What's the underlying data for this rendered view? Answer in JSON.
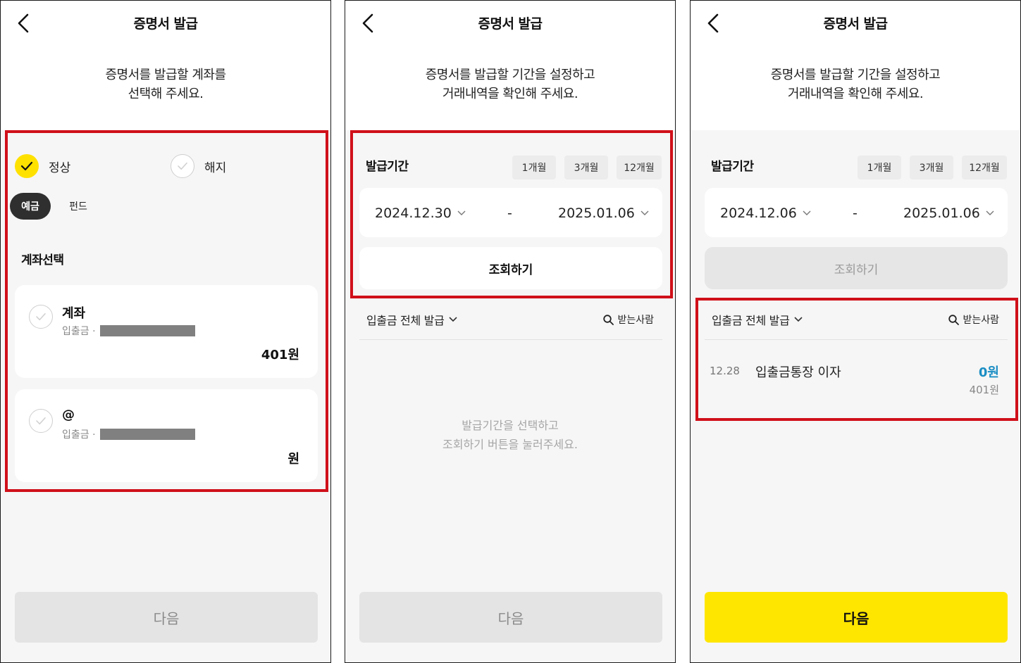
{
  "colors": {
    "accent_yellow": "#ffe600",
    "highlight_red": "#d0101a",
    "amount_blue": "#1b8ec4"
  },
  "panel1": {
    "title": "증명서 발급",
    "desc_line1": "증명서를 발급할 계좌를",
    "desc_line2": "선택해 주세요.",
    "radio_normal": "정상",
    "radio_closed": "해지",
    "tab_deposit": "예금",
    "tab_fund": "펀드",
    "section_label": "계좌선택",
    "accounts": [
      {
        "name": "계좌",
        "type": "입출금 ·",
        "amount": "401원"
      },
      {
        "name": "@",
        "type": "입출금 ·",
        "amount": "원"
      }
    ],
    "next_label": "다음"
  },
  "panel2": {
    "title": "증명서 발급",
    "desc_line1": "증명서를 발급할 기간을 설정하고",
    "desc_line2": "거래내역을 확인해 주세요.",
    "period_label": "발급기간",
    "chips": [
      "1개월",
      "3개월",
      "12개월"
    ],
    "date_from": "2024.12.30",
    "date_to": "2025.01.06",
    "dash": "-",
    "query_label": "조회하기",
    "filter_label": "입출금 전체 발급",
    "recipient_label": "받는사람",
    "empty_line1": "발급기간을 선택하고",
    "empty_line2": "조회하기 버튼을 눌러주세요.",
    "next_label": "다음"
  },
  "panel3": {
    "title": "증명서 발급",
    "desc_line1": "증명서를 발급할 기간을 설정하고",
    "desc_line2": "거래내역을 확인해 주세요.",
    "period_label": "발급기간",
    "chips": [
      "1개월",
      "3개월",
      "12개월"
    ],
    "date_from": "2024.12.06",
    "date_to": "2025.01.06",
    "dash": "-",
    "query_label": "조회하기",
    "filter_label": "입출금 전체 발급",
    "recipient_label": "받는사람",
    "transaction": {
      "date": "12.28",
      "name": "입출금통장 이자",
      "amount": "0원",
      "balance": "401원"
    },
    "next_label": "다음"
  }
}
